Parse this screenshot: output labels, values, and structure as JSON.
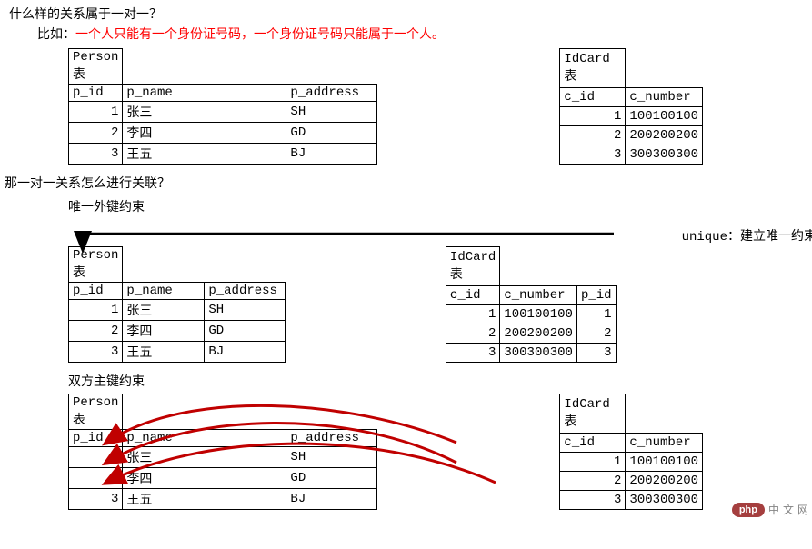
{
  "q1": "什么样的关系属于一对一？",
  "example_prefix": "比如：",
  "example_red": "一个人只能有一个身份证号码，一个身份证号码只能属于一个人。",
  "person_title": "Person表",
  "person_headers": {
    "c0": "p_id",
    "c1": "p_name",
    "c2": "p_address"
  },
  "person_rows": [
    {
      "c0": "1",
      "c1": "张三",
      "c2": "SH"
    },
    {
      "c0": "2",
      "c1": "李四",
      "c2": "GD"
    },
    {
      "c0": "3",
      "c1": "王五",
      "c2": "BJ"
    }
  ],
  "idcard_title": "IdCard表",
  "idcard_headers": {
    "c0": "c_id",
    "c1": "c_number"
  },
  "idcard_rows": [
    {
      "c0": "1",
      "c1": "100100100"
    },
    {
      "c0": "2",
      "c1": "200200200"
    },
    {
      "c0": "3",
      "c1": "300300300"
    }
  ],
  "q2": "那一对一关系怎么进行关联？",
  "sub1": "唯一外键约束",
  "unique_note": "unique：建立唯一约束",
  "idcard3_headers": {
    "c0": "c_id",
    "c1": "c_number",
    "c2": "p_id"
  },
  "idcard3_rows": [
    {
      "c0": "1",
      "c1": "100100100",
      "c2": "1"
    },
    {
      "c0": "2",
      "c1": "200200200",
      "c2": "2"
    },
    {
      "c0": "3",
      "c1": "300300300",
      "c2": "3"
    }
  ],
  "sub2": "双方主键约束",
  "watermark": {
    "badge": "php",
    "text": "中文网"
  }
}
